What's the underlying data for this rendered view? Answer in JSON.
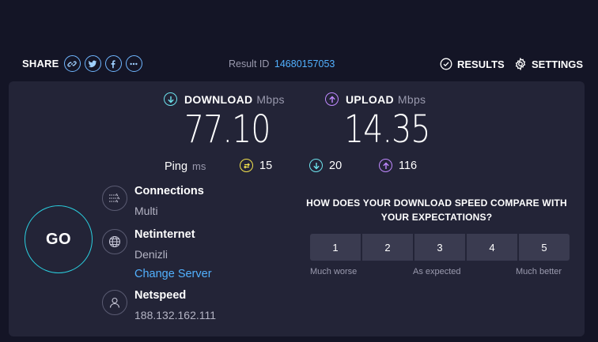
{
  "header": {
    "share_label": "SHARE",
    "share_buttons": [
      {
        "icon": "link-icon"
      },
      {
        "icon": "twitter-icon"
      },
      {
        "icon": "facebook-icon"
      },
      {
        "icon": "more-icon"
      }
    ],
    "result_id_label": "Result ID",
    "result_id": "14680157053",
    "results_label": "RESULTS",
    "settings_label": "SETTINGS"
  },
  "download": {
    "label": "DOWNLOAD",
    "unit": "Mbps",
    "value": "77.10",
    "color": "#6de3ed"
  },
  "upload": {
    "label": "UPLOAD",
    "unit": "Mbps",
    "value": "14.35",
    "color": "#c089ff"
  },
  "ping": {
    "label": "Ping",
    "unit": "ms",
    "idle": "15",
    "download": "20",
    "upload": "116",
    "idle_color": "#f3e24d"
  },
  "go_label": "GO",
  "connections": {
    "title": "Connections",
    "value": "Multi"
  },
  "host": {
    "title": "Netinternet",
    "location": "Denizli",
    "change_label": "Change Server"
  },
  "provider": {
    "title": "Netspeed",
    "ip": "188.132.162.111"
  },
  "survey": {
    "question": "HOW DOES YOUR DOWNLOAD SPEED COMPARE WITH YOUR EXPECTATIONS?",
    "options": [
      "1",
      "2",
      "3",
      "4",
      "5"
    ],
    "low_label": "Much worse",
    "mid_label": "As expected",
    "high_label": "Much better"
  },
  "colors": {
    "background": "#141526",
    "panel": "#232437",
    "accent_link": "#52b1ff",
    "go_ring": "#2ad0e0"
  }
}
